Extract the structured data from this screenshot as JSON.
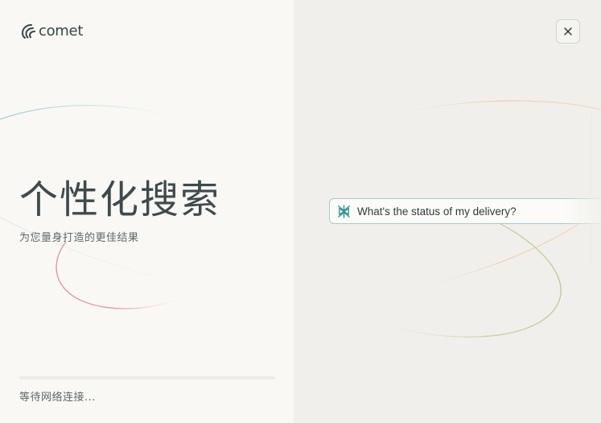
{
  "app": {
    "logo_text": "comet",
    "logo_icon": "comet-logo-icon"
  },
  "hero": {
    "headline": "个性化搜索",
    "subtitle": "为您量身打造的更佳结果"
  },
  "loading": {
    "status_text": "等待网络连接...",
    "progress": 0
  },
  "close_button": {
    "icon": "close-icon"
  },
  "example_query": {
    "icon": "comet-search-icon",
    "text": "What's the status of my delivery?"
  },
  "colors": {
    "accent": "#2f8f95",
    "left_panel_bg": "#f9f8f4",
    "right_panel_bg": "#f0efeb",
    "headline_text": "#3e4a4c"
  }
}
